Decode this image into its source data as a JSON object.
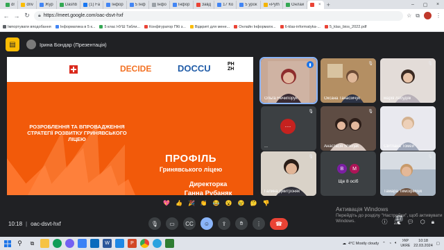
{
  "browser": {
    "tabs": [
      {
        "label": "dr",
        "color": "#34a853"
      },
      {
        "label": "driv",
        "color": "#fbbc04"
      },
      {
        "label": "Жур",
        "color": "#4285f4"
      },
      {
        "label": "Dashb",
        "color": "#34a853"
      },
      {
        "label": "(1) Fa",
        "color": "#1877f2"
      },
      {
        "label": "Інфор",
        "color": "#4285f4"
      },
      {
        "label": "5 Інф",
        "color": "#4285f4"
      },
      {
        "label": "Інфо",
        "color": "#9aa0a6"
      },
      {
        "label": "Інфор",
        "color": "#4285f4"
      },
      {
        "label": "Завд",
        "color": "#ea4335"
      },
      {
        "label": "17 Ко",
        "color": "#4285f4"
      },
      {
        "label": "5 урок",
        "color": "#4285f4"
      },
      {
        "label": "«Pyth",
        "color": "#f4b400"
      },
      {
        "label": "Онлай",
        "color": "#34a853"
      },
      {
        "label": "",
        "color": "#ea4335",
        "active": true
      }
    ],
    "new_tab": "+",
    "url": "https://meet.google.com/oac-dsvt-hxf",
    "bookmarks": [
      {
        "label": "Імпортувати вподобання",
        "color": "#5f6368"
      },
      {
        "label": "Інформатика в 5 к...",
        "color": "#4285f4"
      },
      {
        "label": "5 клас НУШ Табли...",
        "color": "#34a853"
      },
      {
        "label": "Конфігуратор ПКі з...",
        "color": "#ea4335"
      },
      {
        "label": "Відкриті для мене...",
        "color": "#fbbc04"
      },
      {
        "label": "Онлайн Інформати...",
        "color": "#ea4335"
      },
      {
        "label": "6-klas-informatyka-...",
        "color": "#ea4335"
      },
      {
        "label": "5_klas_bios_2022.pdf",
        "color": "#ea4335"
      }
    ]
  },
  "meet": {
    "presenter_name": "Ірина Бондар (Презентація)",
    "slide": {
      "logo_decide": "DECIDE",
      "logo_doccu": "DOCCU",
      "logo_phzh": "PH\nZH",
      "subtitle": "Розроблення та впровадження стратегії розвитку Гринявського ліцею",
      "title": "ПРОФІЛЬ",
      "school": "Гринявського ліцею",
      "role": "Директорка",
      "person": "Ганна Рубаняк"
    },
    "participants": [
      {
        "name": "Ольга Нечипорук",
        "speaking": true
      },
      {
        "name": "Оксана Танасійчук",
        "speaking": false
      },
      {
        "name": "марія лабудяк",
        "speaking": false
      },
      {
        "name": "...",
        "speaking": false
      },
      {
        "name": "Анастасія Shkirjak",
        "speaking": false
      },
      {
        "name": "Світлана Томей",
        "speaking": false
      },
      {
        "name": "Галина дмитроняк",
        "speaking": false
      },
      {
        "name": "Ще 8 осіб",
        "speaking": false
      },
      {
        "name": "Тамара Тимофійчук",
        "speaking": false
      }
    ],
    "more_initials": [
      "B",
      "M"
    ],
    "reactions": [
      "💖",
      "👍",
      "🎉",
      "👏",
      "😂",
      "😮",
      "😢",
      "🤔",
      "👎"
    ],
    "time": "10:18",
    "separator": "|",
    "meeting_code": "oac-dsvt-hxf",
    "participant_count": "17"
  },
  "activation": {
    "title": "Активація Windows",
    "subtitle": "Перейдіть до розділу \"Настройки\", щоб активувати Windows."
  },
  "taskbar": {
    "weather": "4°C  Mostly cloudy",
    "lang": "УКР\nUKRE",
    "time": "10:18",
    "date": "22.03.2024"
  }
}
